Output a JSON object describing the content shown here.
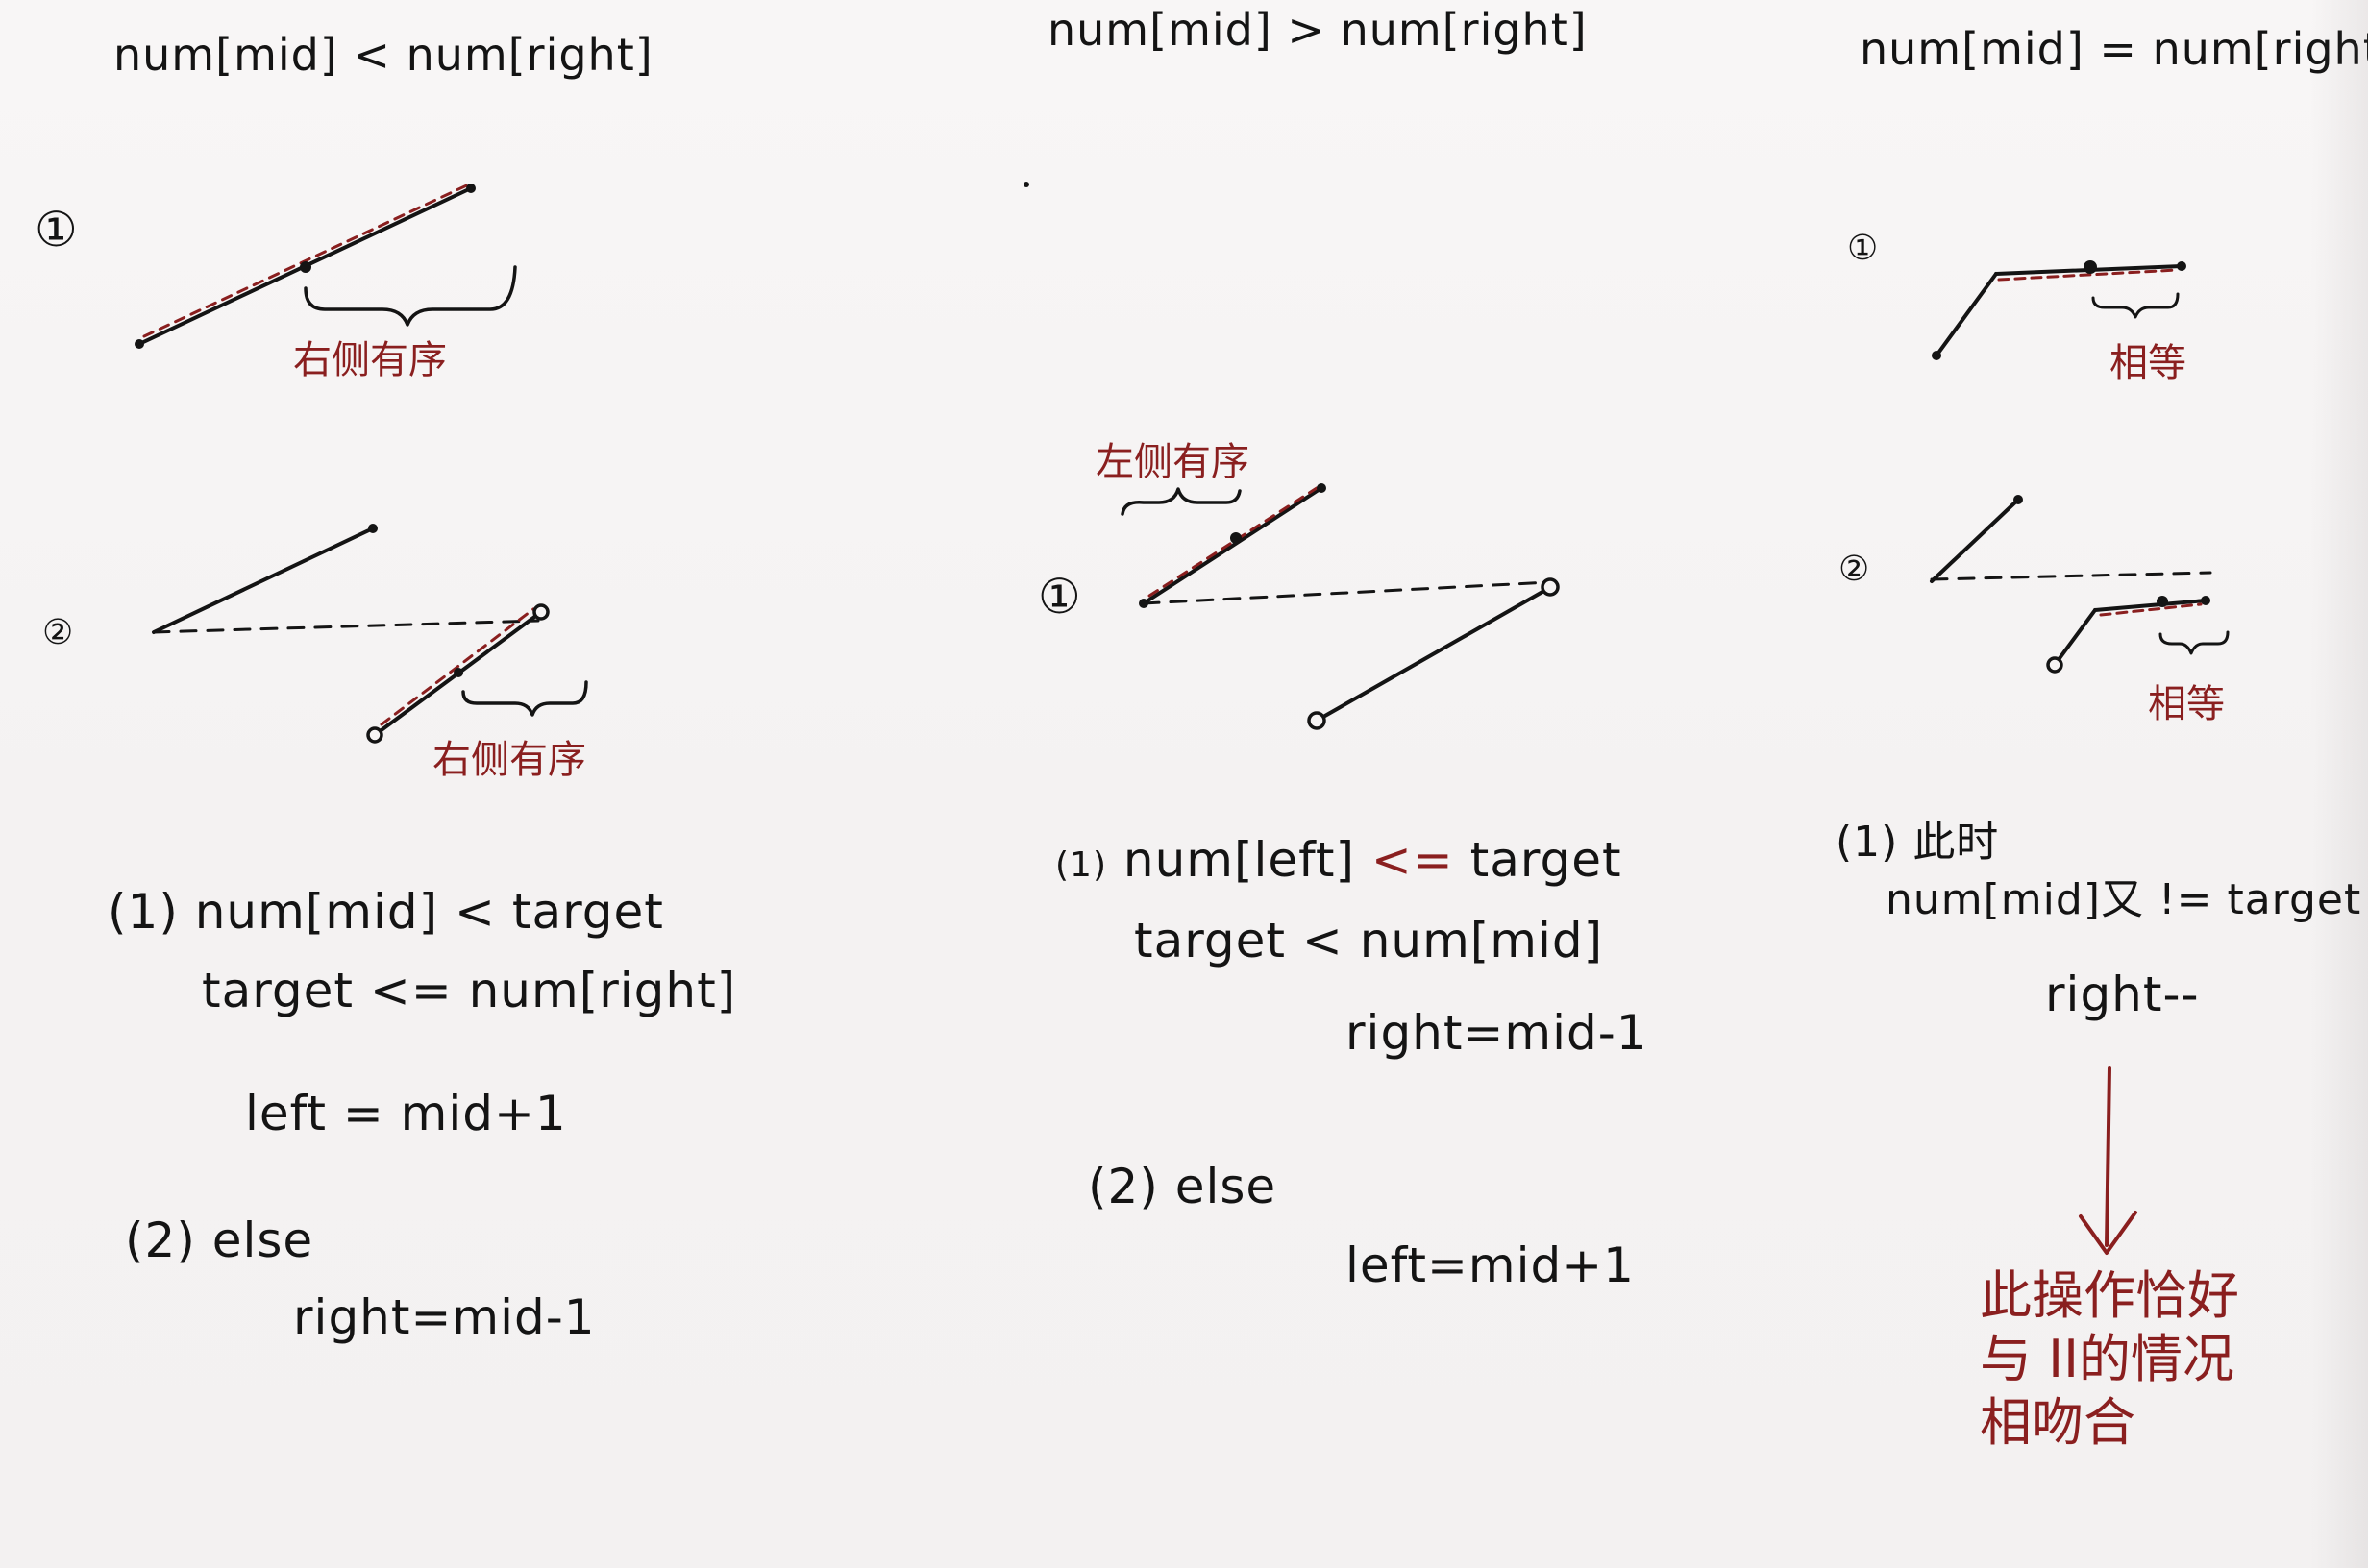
{
  "col1": {
    "header": "num[mid] < num[right]",
    "marker1": "①",
    "label1": "右侧有序",
    "marker2": "②",
    "label2": "右侧有序",
    "line1": "(1) num[mid] < target",
    "line2": "target <= num[right]",
    "line3": "left = mid+1",
    "line4": "(2) else",
    "line5": "right=mid-1"
  },
  "col2": {
    "header": "num[mid] > num[right]",
    "label1": "左侧有序",
    "marker1": "①",
    "line1_prefix": "(1)",
    "line1_a": "num[left]",
    "line1_op": "<=",
    "line1_b": "target",
    "line2": "target < num[mid]",
    "line3": "right=mid-1",
    "line4": "(2) else",
    "line5": "left=mid+1"
  },
  "col3": {
    "header": "num[mid] = num[right]",
    "marker1": "①",
    "label1": "相等",
    "marker2": "②",
    "label2": "相等",
    "line1": "(1) 此时",
    "line2": "num[mid]又 != target",
    "line3": "right--",
    "note_l1": "此操作恰好",
    "note_l2": "与 II的情况",
    "note_l3": "相吻合"
  },
  "colors": {
    "ink": "#141414",
    "red_ink": "#8a1f1f",
    "paper": "#f6f4f4"
  }
}
